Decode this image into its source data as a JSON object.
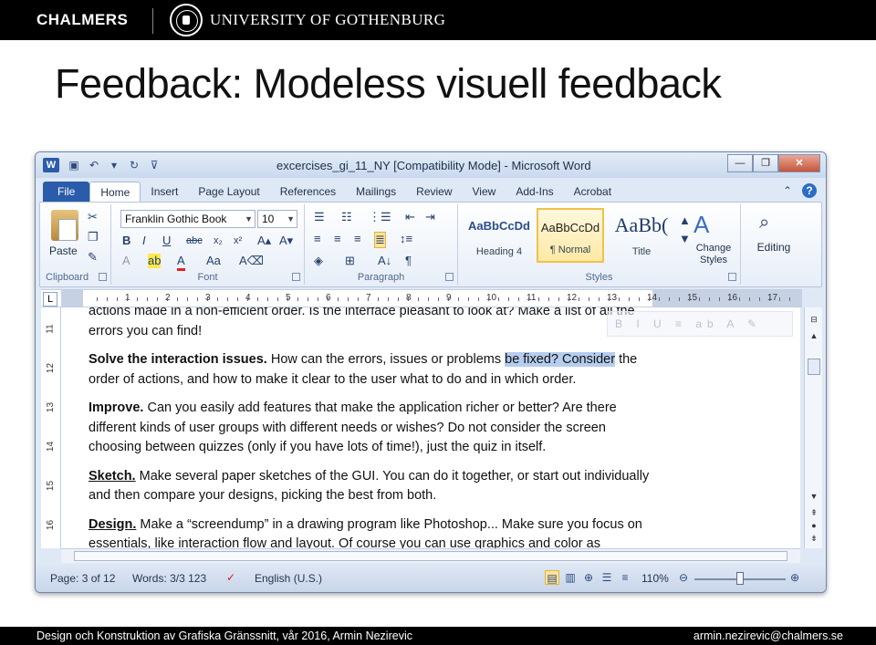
{
  "header": {
    "brand": "CHALMERS",
    "university": "UNIVERSITY OF GOTHENBURG"
  },
  "slide": {
    "title": "Feedback: Modeless visuell feedback"
  },
  "word": {
    "window_title": "excercises_gi_11_NY [Compatibility Mode] - Microsoft Word",
    "app_icon": "W",
    "tabs": [
      "File",
      "Home",
      "Insert",
      "Page Layout",
      "References",
      "Mailings",
      "Review",
      "View",
      "Add-Ins",
      "Acrobat"
    ],
    "ribbon": {
      "paste_label": "Paste",
      "clipboard_label": "Clipboard",
      "font_label": "Font",
      "paragraph_label": "Paragraph",
      "styles_label": "Styles",
      "font_name": "Franklin Gothic Book",
      "font_size": "10",
      "change_styles": "Change Styles",
      "editing": "Editing",
      "styles": [
        {
          "sample": "AaBbCcDd",
          "name": "Heading 4"
        },
        {
          "sample": "AaBbCcDd",
          "name": "¶ Normal"
        },
        {
          "sample": "AaBb(",
          "name": "Title"
        }
      ]
    },
    "ruler_numbers": [
      "1",
      "2",
      "3",
      "4",
      "5",
      "6",
      "7",
      "8",
      "9",
      "10",
      "11",
      "12",
      "13",
      "14",
      "15",
      "16",
      "17"
    ],
    "vruler_numbers": [
      "11",
      "12",
      "13",
      "14",
      "15",
      "16"
    ],
    "doc": {
      "p0": "actions made in a non-efficient order. Is the interface pleasant to look at? Make a list of all the errors you can find!",
      "p1_bold": "Solve the interaction issues.",
      "p1_before": " How can the errors, issues or problems ",
      "p1_highlight": "be fixed? Consider",
      "p1_after": " the order of actions, and how to make it clear to the user what to do and in which order.",
      "p2_bold": "Improve.",
      "p2_text": " Can you easily add features that make the application richer or better? Are there different kinds of user groups with different needs or wishes? Do not consider the screen choosing between quizzes (only if you have lots of time!), just the quiz in itself.",
      "p3_bold": "Sketch.",
      "p3_text": " Make several paper sketches of the GUI. You can do it together, or start out individually and then compare your designs, picking the best from both.",
      "p4_bold": "Design.",
      "p4_text": " Make a “screendump” in a drawing program like Photoshop... Make sure you focus on essentials, like interaction flow and layout. Of course you can use graphics and color as",
      "mini_toolbar": "B I U ≡ ab A ✎"
    },
    "status": {
      "page": "Page: 3 of 12",
      "words": "Words: 3/3 123",
      "language": "English (U.S.)",
      "zoom": "110%"
    }
  },
  "footer": {
    "left": "Design och Konstruktion av Grafiska Gränssnitt,  vår 2016, Armin Nezirevic",
    "right": "armin.nezirevic@chalmers.se"
  }
}
